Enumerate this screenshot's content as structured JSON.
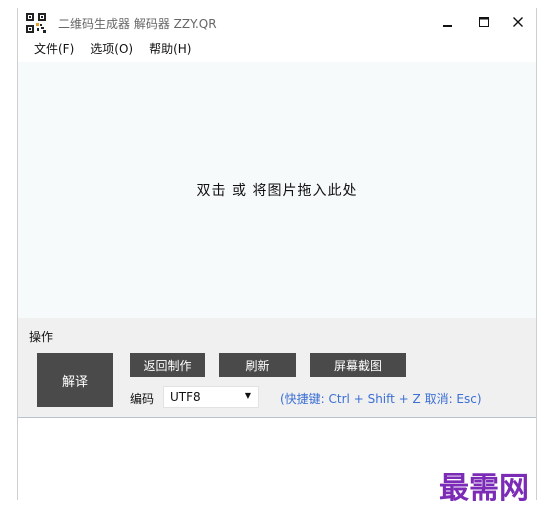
{
  "window": {
    "title": "二维码生成器 解码器 ZZY.QR",
    "controls": {
      "minimize_icon": "minimize-icon",
      "maximize_icon": "maximize-icon",
      "close_icon": "close-icon"
    }
  },
  "menu": {
    "items": [
      {
        "label": "文件(F)"
      },
      {
        "label": "选项(O)"
      },
      {
        "label": "帮助(H)"
      }
    ]
  },
  "drop_zone": {
    "text": "双击 或 将图片拖入此处"
  },
  "operations": {
    "label": "操作",
    "decode_button": "解译",
    "back_button": "返回制作",
    "refresh_button": "刷新",
    "screenshot_button": "屏幕截图",
    "encoding_label": "编码",
    "encoding_value": "UTF8",
    "hint": "(快捷键: Ctrl + Shift + Z  取消: Esc)"
  },
  "watermark": "最需网",
  "colors": {
    "button_bg": "#4a4a4a",
    "hint": "#3b6fd4",
    "watermark": "#7b2bb5",
    "drop_zone_bg": "#f7fafb",
    "panel_bg": "#f0f0f0"
  }
}
